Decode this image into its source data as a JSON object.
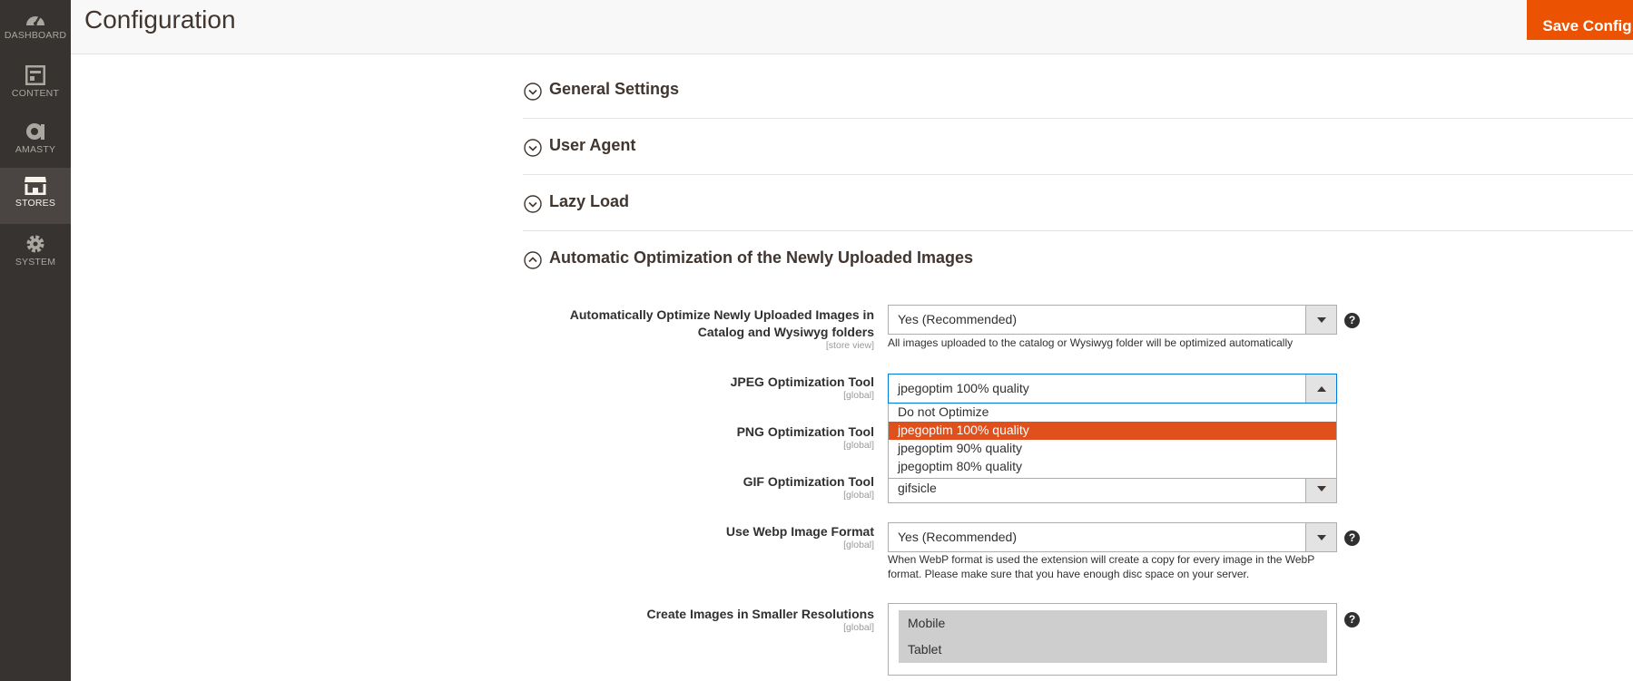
{
  "nav": [
    {
      "label": "DASHBOARD",
      "icon": "dashboard-icon"
    },
    {
      "label": "CONTENT",
      "icon": "content-icon"
    },
    {
      "label": "AMASTY",
      "icon": "amasty-icon"
    },
    {
      "label": "STORES",
      "icon": "stores-icon"
    },
    {
      "label": "SYSTEM",
      "icon": "system-icon"
    }
  ],
  "header": {
    "title": "Configuration",
    "save_label": "Save Config"
  },
  "sections": [
    {
      "title": "General Settings",
      "state": "collapsed"
    },
    {
      "title": "User Agent",
      "state": "collapsed"
    },
    {
      "title": "Lazy Load",
      "state": "collapsed"
    },
    {
      "title": "Automatic Optimization of the Newly Uploaded Images",
      "state": "expanded"
    }
  ],
  "fields": {
    "auto_optimize": {
      "label": "Automatically Optimize Newly Uploaded Images in Catalog and Wysiwyg folders",
      "scope": "[store view]",
      "value": "Yes (Recommended)",
      "note": "All images uploaded to the catalog or Wysiwyg folder will be optimized automatically"
    },
    "jpeg_tool": {
      "label": "JPEG Optimization Tool",
      "scope": "[global]",
      "value": "jpegoptim 100% quality",
      "options": [
        "Do not Optimize",
        "jpegoptim 100% quality",
        "jpegoptim 90% quality",
        "jpegoptim 80% quality"
      ]
    },
    "png_tool": {
      "label": "PNG Optimization Tool",
      "scope": "[global]"
    },
    "gif_tool": {
      "label": "GIF Optimization Tool",
      "scope": "[global]",
      "value": "gifsicle"
    },
    "webp": {
      "label": "Use Webp Image Format",
      "scope": "[global]",
      "value": "Yes (Recommended)",
      "note": "When WebP format is used the extension will create a copy for every image in the WebP format. Please make sure that you have enough disc space on your server."
    },
    "resolutions": {
      "label": "Create Images in Smaller Resolutions",
      "scope": "[global]",
      "options": [
        "Mobile",
        "Tablet"
      ]
    }
  },
  "help_symbol": "?",
  "colors": {
    "accent": "#eb5202",
    "sidebar": "#373330",
    "selected_option": "#e0501d"
  }
}
